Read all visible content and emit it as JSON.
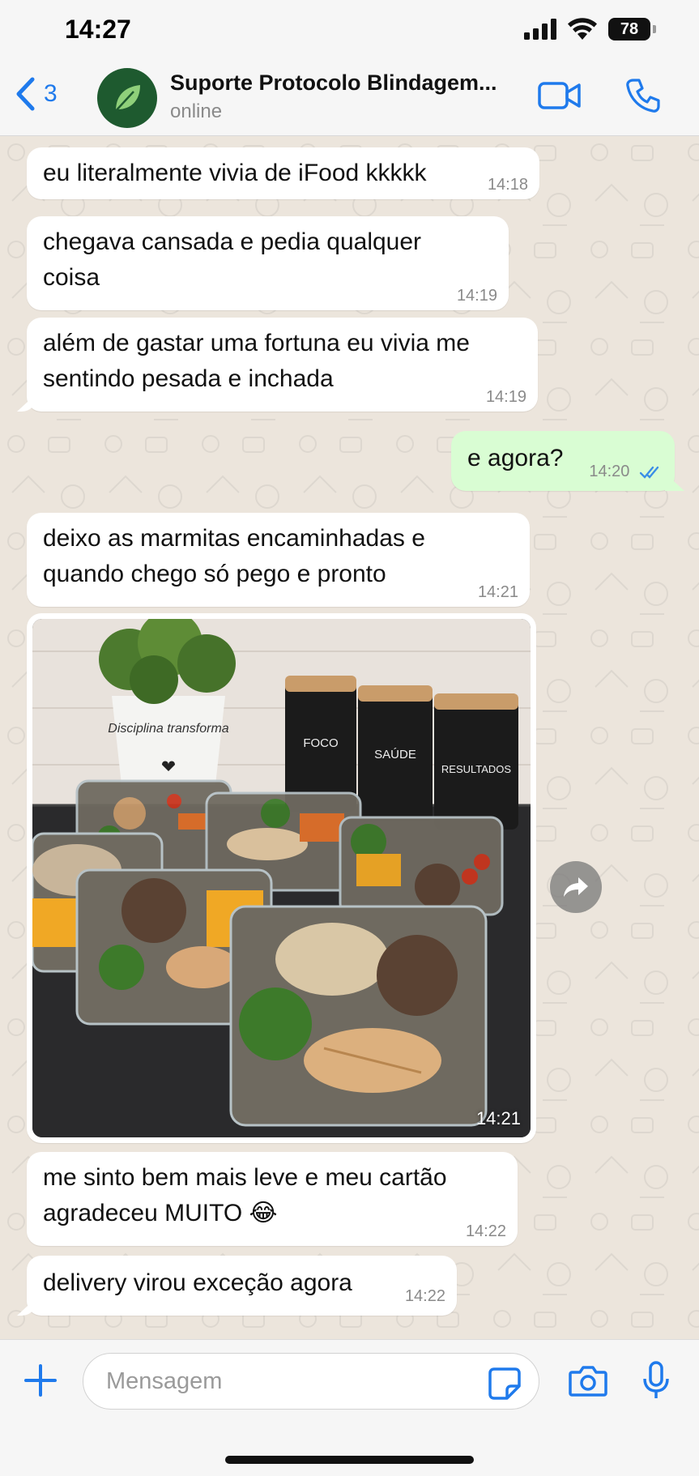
{
  "status_bar": {
    "time": "14:27",
    "battery": "78",
    "icons": [
      "signal-icon",
      "wifi-icon",
      "battery-icon"
    ]
  },
  "header": {
    "back_count": "3",
    "contact_name": "Suporte Protocolo Blindagem...",
    "contact_status": "online",
    "avatar_icon": "leaf-icon",
    "accent_color": "#1f7aec"
  },
  "messages": [
    {
      "direction": "in",
      "text": "eu literalmente vivia de iFood kkkkk",
      "time": "14:18"
    },
    {
      "direction": "in",
      "text": "chegava cansada e pedia qualquer coisa",
      "time": "14:19"
    },
    {
      "direction": "in",
      "text": "além de gastar uma fortuna eu vivia me sentindo pesada e inchada",
      "time": "14:19"
    },
    {
      "direction": "out",
      "text": "e agora?",
      "time": "14:20",
      "read": true
    },
    {
      "direction": "in",
      "text": "deixo as marmitas encaminhadas e quando chego só pego e pronto",
      "time": "14:21"
    },
    {
      "direction": "in",
      "type": "image",
      "time": "14:21",
      "image_text": {
        "pot": "Disciplina transforma",
        "jar1": "FOCO",
        "jar2": "SAÚDE",
        "jar3": "RESULTADOS"
      }
    },
    {
      "direction": "in",
      "text": "me sinto bem mais leve e meu cartão agradeceu MUITO 😂",
      "time": "14:22"
    },
    {
      "direction": "in",
      "text": "delivery virou exceção agora",
      "time": "14:22"
    }
  ],
  "input": {
    "placeholder": "Mensagem",
    "value": ""
  },
  "colors": {
    "chat_bg": "#ece5dc",
    "incoming_bubble": "#ffffff",
    "outgoing_bubble": "#d9fdd3",
    "read_tick": "#3a8ee6"
  }
}
